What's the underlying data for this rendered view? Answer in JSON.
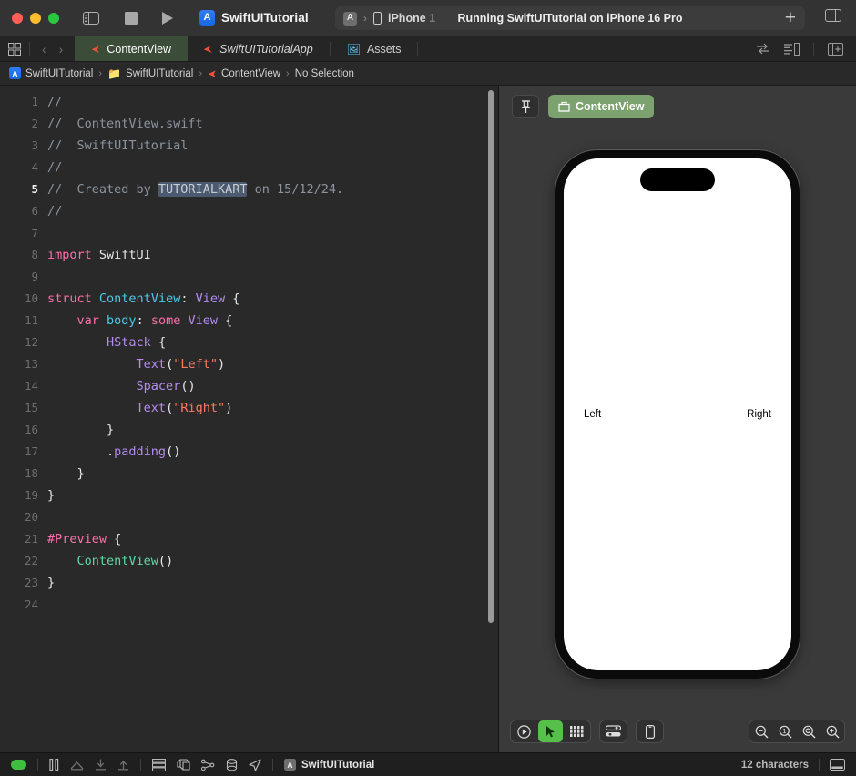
{
  "window": {
    "app_icon": "xcode-icon",
    "project_title": "SwiftUITutorial",
    "sidebar_toggle": "sidebar-toggle-icon",
    "stop": "stop-icon",
    "run": "run-icon",
    "add": "+",
    "inspector_toggle": "inspector-toggle-icon"
  },
  "scheme": {
    "app_icon": "xcode-mini-icon",
    "separator": "›",
    "device_icon": "iphone-icon",
    "device_name": "iPhone ",
    "device_name_faded": "1",
    "status": "Running SwiftUITutorial on iPhone 16 Pro"
  },
  "tabs": {
    "grid_icon": "grid-icon",
    "back": "‹",
    "forward": "›",
    "items": [
      {
        "label": "ContentView",
        "icon": "swift-file-icon",
        "active": true,
        "italic": false
      },
      {
        "label": "SwiftUITutorialApp",
        "icon": "swift-file-icon",
        "active": false,
        "italic": true
      },
      {
        "label": "Assets",
        "icon": "assets-icon",
        "active": false,
        "italic": false
      }
    ],
    "right_icons": [
      "compare-versions-icon",
      "minimap-icon",
      "add-editor-icon"
    ]
  },
  "breadcrumb": {
    "separator": "›",
    "items": [
      {
        "label": "SwiftUITutorial",
        "icon": "project-icon"
      },
      {
        "label": "SwiftUITutorial",
        "icon": "folder-icon"
      },
      {
        "label": "ContentView",
        "icon": "swift-file-icon"
      },
      {
        "label": "No Selection",
        "icon": ""
      }
    ]
  },
  "editor": {
    "current_line": 5,
    "total_lines": 24,
    "lines": [
      {
        "n": 1,
        "tokens": [
          {
            "t": "//",
            "c": "c-comment"
          }
        ]
      },
      {
        "n": 2,
        "tokens": [
          {
            "t": "//  ContentView.swift",
            "c": "c-comment"
          }
        ]
      },
      {
        "n": 3,
        "tokens": [
          {
            "t": "//  SwiftUITutorial",
            "c": "c-comment"
          }
        ]
      },
      {
        "n": 4,
        "tokens": [
          {
            "t": "//",
            "c": "c-comment"
          }
        ]
      },
      {
        "n": 5,
        "tokens": [
          {
            "t": "//  Created by ",
            "c": "c-comment"
          },
          {
            "t": "TUTORIALKART",
            "c": "c-comment sel"
          },
          {
            "t": " on 15/12/24.",
            "c": "c-comment"
          }
        ]
      },
      {
        "n": 6,
        "tokens": [
          {
            "t": "//",
            "c": "c-comment"
          }
        ]
      },
      {
        "n": 7,
        "tokens": []
      },
      {
        "n": 8,
        "tokens": [
          {
            "t": "import",
            "c": "c-keyword"
          },
          {
            "t": " ",
            "c": "c-plain"
          },
          {
            "t": "SwiftUI",
            "c": "c-plain"
          }
        ]
      },
      {
        "n": 9,
        "tokens": []
      },
      {
        "n": 10,
        "tokens": [
          {
            "t": "struct",
            "c": "c-keyword"
          },
          {
            "t": " ",
            "c": "c-plain"
          },
          {
            "t": "ContentView",
            "c": "c-ident"
          },
          {
            "t": ": ",
            "c": "c-plain"
          },
          {
            "t": "View",
            "c": "c-type"
          },
          {
            "t": " {",
            "c": "c-plain"
          }
        ]
      },
      {
        "n": 11,
        "tokens": [
          {
            "t": "    ",
            "c": "c-plain"
          },
          {
            "t": "var",
            "c": "c-keyword"
          },
          {
            "t": " ",
            "c": "c-plain"
          },
          {
            "t": "body",
            "c": "c-ident"
          },
          {
            "t": ": ",
            "c": "c-plain"
          },
          {
            "t": "some",
            "c": "c-keyword"
          },
          {
            "t": " ",
            "c": "c-plain"
          },
          {
            "t": "View",
            "c": "c-type"
          },
          {
            "t": " {",
            "c": "c-plain"
          }
        ]
      },
      {
        "n": 12,
        "tokens": [
          {
            "t": "        ",
            "c": "c-plain"
          },
          {
            "t": "HStack",
            "c": "c-func"
          },
          {
            "t": " {",
            "c": "c-plain"
          }
        ]
      },
      {
        "n": 13,
        "tokens": [
          {
            "t": "            ",
            "c": "c-plain"
          },
          {
            "t": "Text",
            "c": "c-func"
          },
          {
            "t": "(",
            "c": "c-plain"
          },
          {
            "t": "\"Left\"",
            "c": "c-string"
          },
          {
            "t": ")",
            "c": "c-plain"
          }
        ]
      },
      {
        "n": 14,
        "tokens": [
          {
            "t": "            ",
            "c": "c-plain"
          },
          {
            "t": "Spacer",
            "c": "c-func"
          },
          {
            "t": "()",
            "c": "c-plain"
          }
        ]
      },
      {
        "n": 15,
        "tokens": [
          {
            "t": "            ",
            "c": "c-plain"
          },
          {
            "t": "Text",
            "c": "c-func"
          },
          {
            "t": "(",
            "c": "c-plain"
          },
          {
            "t": "\"Right\"",
            "c": "c-string"
          },
          {
            "t": ")",
            "c": "c-plain"
          }
        ]
      },
      {
        "n": 16,
        "tokens": [
          {
            "t": "        }",
            "c": "c-plain"
          }
        ]
      },
      {
        "n": 17,
        "tokens": [
          {
            "t": "        .",
            "c": "c-plain"
          },
          {
            "t": "padding",
            "c": "c-func"
          },
          {
            "t": "()",
            "c": "c-plain"
          }
        ]
      },
      {
        "n": 18,
        "tokens": [
          {
            "t": "    }",
            "c": "c-plain"
          }
        ]
      },
      {
        "n": 19,
        "tokens": [
          {
            "t": "}",
            "c": "c-plain"
          }
        ]
      },
      {
        "n": 20,
        "tokens": []
      },
      {
        "n": 21,
        "tokens": [
          {
            "t": "#Preview",
            "c": "c-pre"
          },
          {
            "t": " {",
            "c": "c-plain"
          }
        ]
      },
      {
        "n": 22,
        "tokens": [
          {
            "t": "    ",
            "c": "c-plain"
          },
          {
            "t": "ContentView",
            "c": "c-green"
          },
          {
            "t": "()",
            "c": "c-plain"
          }
        ]
      },
      {
        "n": 23,
        "tokens": [
          {
            "t": "}",
            "c": "c-plain"
          }
        ]
      },
      {
        "n": 24,
        "tokens": []
      }
    ]
  },
  "canvas": {
    "pin_icon": "pin-icon",
    "preview_label": "ContentView",
    "preview_icon": "preview-device-icon",
    "preview_pill_color": "#7ba26f",
    "device": {
      "model": "iPhone 16 Pro",
      "left_text": "Left",
      "right_text": "Right"
    },
    "toolbar": {
      "group1": [
        {
          "name": "live-preview-icon",
          "glyph": "▶",
          "active": false
        },
        {
          "name": "selectable-cursor-icon",
          "glyph": "➤",
          "active": true
        },
        {
          "name": "variants-grid-icon",
          "glyph": "∷",
          "active": false
        }
      ],
      "group2": [
        {
          "name": "device-settings-icon",
          "glyph": "≡",
          "active": false
        }
      ],
      "group3": [
        {
          "name": "device-frame-icon",
          "glyph": "▯",
          "active": false
        }
      ],
      "zoom_group": [
        {
          "name": "zoom-out-icon",
          "glyph": "−"
        },
        {
          "name": "zoom-actual-size-icon",
          "glyph": "1"
        },
        {
          "name": "zoom-to-fit-icon",
          "glyph": "◎"
        },
        {
          "name": "zoom-in-icon",
          "glyph": "+"
        }
      ]
    }
  },
  "statusbar": {
    "run_indicator_color": "#3fbf3f",
    "icons": [
      {
        "name": "pause-icon",
        "glyph": "⏸"
      },
      {
        "name": "step-over-icon",
        "glyph": "⤴"
      },
      {
        "name": "step-into-icon",
        "glyph": "↓"
      },
      {
        "name": "step-out-icon",
        "glyph": "↑"
      },
      {
        "name": "debug-view-hierarchy-icon",
        "glyph": "☰"
      },
      {
        "name": "memory-graph-icon",
        "glyph": "❖"
      },
      {
        "name": "environment-overrides-icon",
        "glyph": "∴"
      },
      {
        "name": "simulate-location-icon",
        "glyph": "≣"
      },
      {
        "name": "location-arrow-icon",
        "glyph": "➤"
      }
    ],
    "project_label": "SwiftUITutorial",
    "project_icon": "xcode-mini-icon",
    "character_count": "12 characters",
    "panel_toggle_icon": "debug-area-toggle-icon"
  }
}
